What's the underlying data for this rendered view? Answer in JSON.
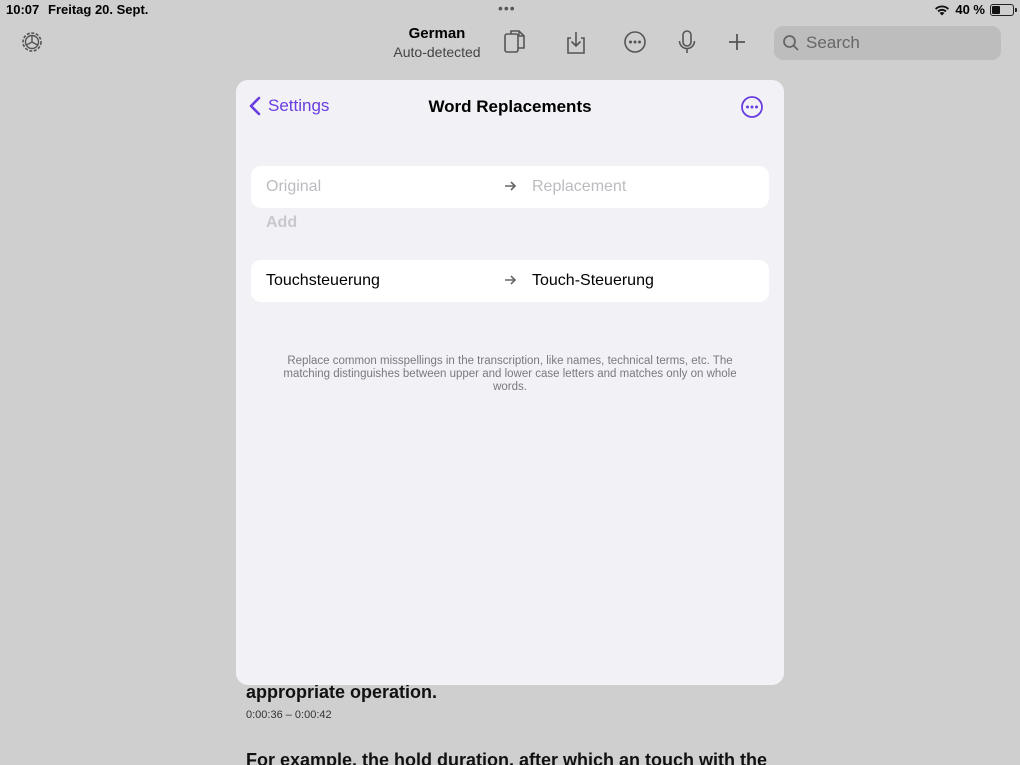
{
  "status_bar": {
    "time": "10:07",
    "date": "Freitag 20. Sept.",
    "battery": "40 %",
    "battery_level": 0.4
  },
  "toolbar": {
    "language": "German",
    "language_subtitle": "Auto-detected",
    "search_placeholder": "Search",
    "icons": [
      "gear-icon",
      "copy-icon",
      "download-icon",
      "more-icon",
      "microphone-icon",
      "plus-icon",
      "search-icon"
    ]
  },
  "background": {
    "line1": "appropriate operation.",
    "timestamp": "0:00:36 – 0:00:42",
    "line2": "For example, the hold duration, after which an touch with the"
  },
  "modal": {
    "back_label": "Settings",
    "title": "Word Replacements",
    "new_entry": {
      "original_placeholder": "Original",
      "replacement_placeholder": "Replacement",
      "add_label": "Add"
    },
    "replacements": [
      {
        "original": "Touchsteuerung",
        "replacement": "Touch-Steuerung"
      }
    ],
    "footnote": "Replace common misspellings in the transcription, like names, technical terms, etc. The matching distinguishes between upper and lower case letters and matches only on whole words."
  },
  "colors": {
    "accent": "#6a3de0",
    "backdrop": "#cfcfcf",
    "sheet": "#f2f2f6"
  }
}
